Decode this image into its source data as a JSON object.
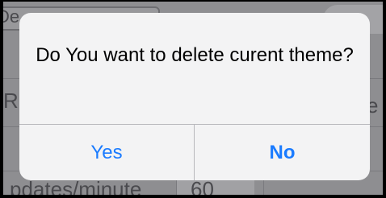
{
  "background": {
    "top_pill_text": "De",
    "left_label": "Remo",
    "right_label": "e",
    "bottom_label": "pdates/minute",
    "bottom_value": "60"
  },
  "alert": {
    "message": "Do You want to delete curent theme?",
    "buttons": [
      {
        "label": "Yes"
      },
      {
        "label": "No"
      }
    ]
  },
  "colors": {
    "accent": "#1a7bff",
    "alert_background": "#f3f3f4",
    "dim_overlay": "#8e8e91"
  }
}
